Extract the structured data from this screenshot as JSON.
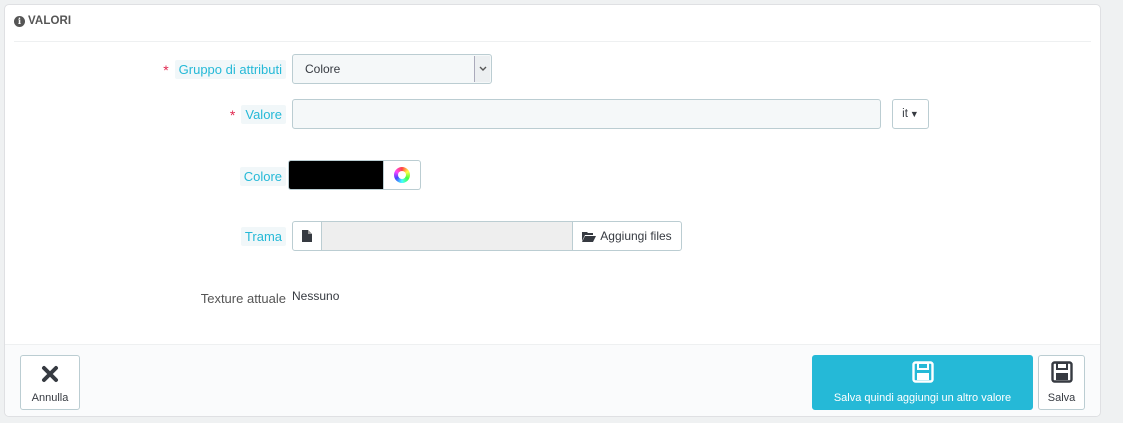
{
  "panel": {
    "heading": "VALORI"
  },
  "form": {
    "attribute_group": {
      "label": "Gruppo di attributi",
      "value": "Colore"
    },
    "value": {
      "label": "Valore",
      "text": "",
      "language": "it"
    },
    "color": {
      "label": "Colore",
      "hex": "#000000"
    },
    "texture": {
      "label": "Trama",
      "button_label": "Aggiungi files"
    },
    "current_texture": {
      "label": "Texture attuale",
      "value": "Nessuno"
    }
  },
  "footer": {
    "cancel_label": "Annulla",
    "save_and_add_label": "Salva quindi aggiungi un altro valore",
    "save_label": "Salva"
  },
  "colors": {
    "accent": "#25b9d7",
    "required": "#e0284f"
  }
}
